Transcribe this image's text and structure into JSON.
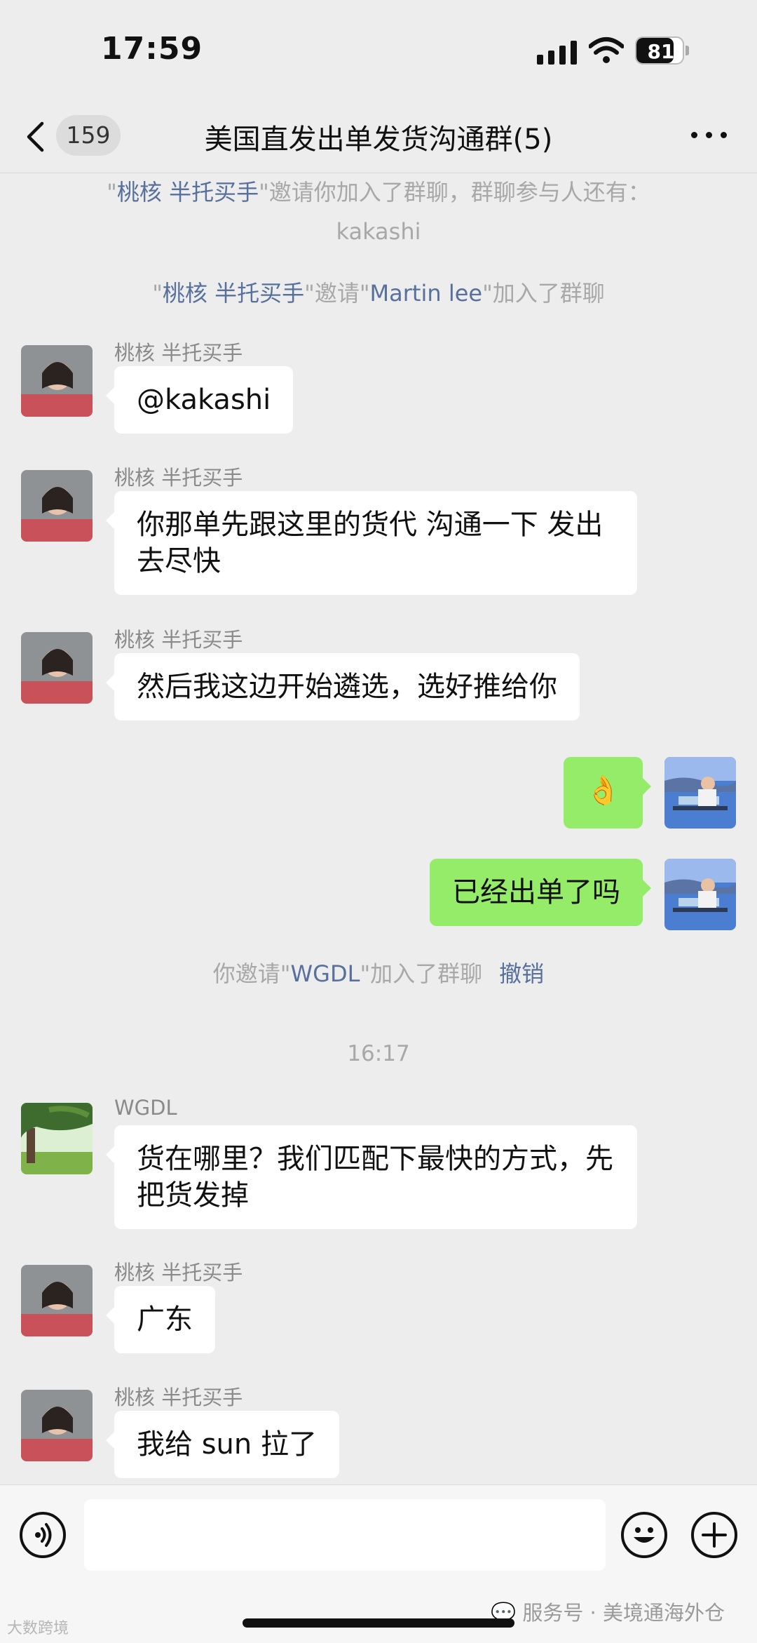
{
  "status_bar": {
    "time": "17:59",
    "battery": "81",
    "battery_level": 0.81
  },
  "nav": {
    "unread_count": "159",
    "title": "美国直发出单发货沟通群(5)"
  },
  "system_messages": {
    "invite1_q1": "\"",
    "invite1_names": "桃核  半托买手",
    "invite1_rest": "\"邀请你加入了群聊，群聊参与人还有：",
    "invite1_line2": "kakashi",
    "invite2_q1": "\"",
    "invite2_inviter": "桃核  半托买手",
    "invite2_mid": "\"邀请\"",
    "invite2_invitee": "Martin lee",
    "invite2_rest": "\"加入了群聊",
    "invite3_pre": "你邀请\"",
    "invite3_name": "WGDL",
    "invite3_rest": "\"加入了群聊",
    "invite3_revoke": "撤销"
  },
  "time_separator": "16:17",
  "messages": [
    {
      "sender": "桃核  半托买手",
      "text": "@kakashi"
    },
    {
      "sender": "桃核  半托买手",
      "text": "你那单先跟这里的货代  沟通一下 发出去尽快"
    },
    {
      "sender": "桃核  半托买手",
      "text": "然后我这边开始遴选，选好推给你"
    },
    {
      "sender": "me",
      "text": "👌"
    },
    {
      "sender": "me",
      "text": "已经出单了吗"
    },
    {
      "sender": "WGDL",
      "text": "货在哪里？我们匹配下最快的方式，先把货发掉"
    },
    {
      "sender": "桃核  半托买手",
      "text": "广东"
    },
    {
      "sender": "桃核  半托买手",
      "text": "我给 sun 拉了"
    }
  ],
  "input_bar": {
    "voice_icon": "voice-icon",
    "emoji_icon": "emoji-icon",
    "plus_icon": "plus-icon"
  },
  "watermarks": {
    "left": "大数跨境",
    "right": "服务号 · 美境通海外仓"
  },
  "colors": {
    "background": "#ededed",
    "my_bubble": "#95ec69",
    "link": "#57709c"
  }
}
